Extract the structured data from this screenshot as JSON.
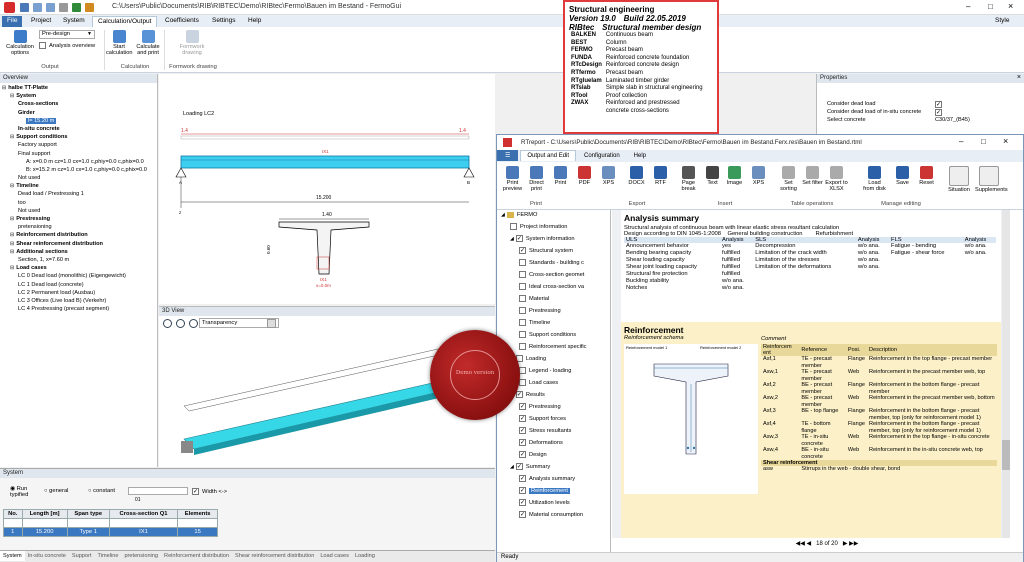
{
  "title_bar": {
    "path": "C:\\Users\\Public\\Documents\\RIB\\RIBTEC\\Demo\\RIBtec\\Fermo\\Bauen im Bestand - FermoGui"
  },
  "menu": {
    "items": [
      "File",
      "Project",
      "System",
      "Calculation/Output",
      "Coefficients",
      "Settings",
      "Help"
    ],
    "active": "Calculation/Output",
    "style_label": "Style"
  },
  "ribbon": {
    "calc_options": "Calculation options",
    "preset": "Pre-design",
    "analysis_overview": "Analysis overview",
    "group_output": "Output",
    "start_calc": "Start calculation",
    "calc_print": "Calculate and print",
    "group_calc": "Calculation",
    "formwork": "Formwork drawing",
    "group_formwork": "Formwork drawing"
  },
  "overview": {
    "header": "Overview",
    "items": [
      {
        "text": "halbe TT-Platte",
        "bold": true,
        "lvl": 0
      },
      {
        "text": "System",
        "bold": true,
        "lvl": 1
      },
      {
        "text": "Cross-sections",
        "bold": true,
        "lvl": 2
      },
      {
        "text": "Girder",
        "bold": true,
        "lvl": 2
      },
      {
        "text": "l= 15.20 m",
        "sel": true,
        "lvl": 3
      },
      {
        "text": "In-situ concrete",
        "bold": true,
        "lvl": 2
      },
      {
        "text": "Support conditions",
        "bold": true,
        "lvl": 1
      },
      {
        "text": "Factory support",
        "lvl": 2
      },
      {
        "text": "Final support",
        "lvl": 2
      },
      {
        "text": "A: x=0.0 m  cz=1.0 cx=1.0 c,phiy=0.0 c,phix=0.0",
        "lvl": 3
      },
      {
        "text": "B: x=15.2 m  cz=1.0 cx=1.0 c,phiy=0.0 c,phix=0.0",
        "lvl": 3
      },
      {
        "text": "Not used",
        "lvl": 2
      },
      {
        "text": "Timeline",
        "bold": true,
        "lvl": 1
      },
      {
        "text": "Dead load / Prestressing 1",
        "lvl": 2
      },
      {
        "text": "too",
        "lvl": 2
      },
      {
        "text": "Not used",
        "lvl": 2
      },
      {
        "text": "Prestressing",
        "bold": true,
        "lvl": 1
      },
      {
        "text": "pretensioning",
        "lvl": 2
      },
      {
        "text": "Reinforcement distribution",
        "bold": true,
        "lvl": 1
      },
      {
        "text": "Shear reinforcement distribution",
        "bold": true,
        "lvl": 1
      },
      {
        "text": "Additional sections",
        "bold": true,
        "lvl": 1
      },
      {
        "text": "Section, 1, x=7.60 m",
        "lvl": 2
      },
      {
        "text": "Load cases",
        "bold": true,
        "lvl": 1
      },
      {
        "text": "LC 0 Dead load (monolithic) (Eigengewicht)",
        "lvl": 2
      },
      {
        "text": "LC 1 Dead load (concrete)",
        "lvl": 2
      },
      {
        "text": "LC 2 Permanent load (Ausbau)",
        "lvl": 2
      },
      {
        "text": "LC 3 Offices (Live load B) (Verkehr)",
        "lvl": 2
      },
      {
        "text": "LC 4 Prestressing (precast segment)",
        "lvl": 2
      }
    ]
  },
  "drawing": {
    "loading": "Loading LC2",
    "q_left": "1.4",
    "q_right": "1.4",
    "span": "15.200",
    "ix": "IX1",
    "a": "A",
    "b": "B",
    "width": "1.40",
    "height": "0.60",
    "ix2": "IX1",
    "xpos": "x=0.0m",
    "axis": "z"
  },
  "view3d": {
    "header": "3D View",
    "transparency": "Transparency"
  },
  "system": {
    "header": "System",
    "radio": [
      "Run typified",
      "general",
      "constant"
    ],
    "width_label": "Width <->",
    "field": "01",
    "cols": [
      "No.",
      "Length [m]",
      "Span type",
      "Cross-section Q1",
      "Elements"
    ],
    "row": [
      "1",
      "15.200",
      "Type 1",
      "IX1",
      "15"
    ]
  },
  "bottom_tabs": [
    "System",
    "In-situ concrete",
    "Support",
    "Timeline",
    "pretensioning",
    "Reinforcement distribution",
    "Shear reinforcement distribution",
    "Load cases",
    "Loading"
  ],
  "properties": {
    "header": "Properties",
    "rows": [
      {
        "label": "Consider dead load",
        "value": "checked"
      },
      {
        "label": "Consider dead load of in-situ concrete",
        "value": "checked"
      },
      {
        "label": "Select concrete",
        "value": "C30/37_(B45)"
      }
    ]
  },
  "info": {
    "title": "Structural engineering",
    "version": "Version 19.0",
    "build": "Build  22.05.2019",
    "ribtec": "RIBtec",
    "sub": "Structural member design",
    "mods": [
      [
        "BALKEN",
        "Continuous beam"
      ],
      [
        "BEST",
        "Column"
      ],
      [
        "FERMO",
        "Precast beam"
      ],
      [
        "FUNDA",
        "Reinforced concrete foundation"
      ],
      [
        "RTcDesign",
        "Reinforced concrete design"
      ],
      [
        "RTfermo",
        "Precast beam"
      ],
      [
        "RTgluelam",
        "Laminated timber girder"
      ],
      [
        "RTslab",
        "Simple slab in structural engineering"
      ],
      [
        "RTool",
        "Proof collection"
      ],
      [
        "ZWAX",
        "Reinforced and prestressed"
      ],
      [
        "",
        "concrete cross-sections"
      ]
    ]
  },
  "rt": {
    "title": "RTreport - C:\\Users\\Public\\Documents\\RIB\\RIBTEC\\Demo\\RIBtec\\Fermo\\Bauen im Bestand.Ferx.res\\Bauen im Bestand.rtml",
    "tabs": [
      "Output and Edit",
      "Configuration",
      "Help"
    ],
    "buttons": [
      "Print preview",
      "Direct print",
      "Print",
      "PDF",
      "XPS",
      "DOCX",
      "RTF",
      "Page break",
      "Text",
      "Image",
      "XPS",
      "Set sorting",
      "Set filter",
      "Export to XLSX",
      "Load from disk",
      "Save",
      "Reset",
      "Situation",
      "Supplements"
    ],
    "groups": [
      "Print",
      "Export",
      "Insert",
      "Table operations",
      "Manage editing"
    ],
    "tree": [
      {
        "t": "FERMO",
        "lvl": 0,
        "cb": false,
        "exp": true
      },
      {
        "t": "Project information",
        "lvl": 1,
        "cb": "off"
      },
      {
        "t": "System information",
        "lvl": 1,
        "cb": "on",
        "exp": true
      },
      {
        "t": "Structural system",
        "lvl": 2,
        "cb": "on"
      },
      {
        "t": "Standards - building c",
        "lvl": 2,
        "cb": "off"
      },
      {
        "t": "Cross-section geomet",
        "lvl": 2,
        "cb": "off"
      },
      {
        "t": "Ideal cross-section va",
        "lvl": 2,
        "cb": "off"
      },
      {
        "t": "Material",
        "lvl": 2,
        "cb": "off"
      },
      {
        "t": "Prestressing",
        "lvl": 2,
        "cb": "off"
      },
      {
        "t": "Timeline",
        "lvl": 2,
        "cb": "off"
      },
      {
        "t": "Support conditions",
        "lvl": 2,
        "cb": "off"
      },
      {
        "t": "Reinforcement specific",
        "lvl": 2,
        "cb": "off"
      },
      {
        "t": "Loading",
        "lvl": 1,
        "cb": "off",
        "exp": true
      },
      {
        "t": "Legend - loading",
        "lvl": 2,
        "cb": "off"
      },
      {
        "t": "Load cases",
        "lvl": 2,
        "cb": "off"
      },
      {
        "t": "Results",
        "lvl": 1,
        "cb": "on",
        "exp": true
      },
      {
        "t": "Prestressing",
        "lvl": 2,
        "cb": "on"
      },
      {
        "t": "Support forces",
        "lvl": 2,
        "cb": "on"
      },
      {
        "t": "Stress resultants",
        "lvl": 2,
        "cb": "on"
      },
      {
        "t": "Deformations",
        "lvl": 2,
        "cb": "on"
      },
      {
        "t": "Design",
        "lvl": 2,
        "cb": "on"
      },
      {
        "t": "Summary",
        "lvl": 1,
        "cb": "on",
        "exp": true
      },
      {
        "t": "Analysis summary",
        "lvl": 2,
        "cb": "on"
      },
      {
        "t": "Reinforcement",
        "lvl": 2,
        "cb": "on",
        "sel": true
      },
      {
        "t": "Utilization levels",
        "lvl": 2,
        "cb": "on"
      },
      {
        "t": "Material consumption",
        "lvl": 2,
        "cb": "on"
      }
    ],
    "analysis": {
      "heading": "Analysis summary",
      "line1": "Structural analysis of continuous beam   with linear elastic stress resultant calculation",
      "line2a": "Design according to DIN 1045-1:2008",
      "line2b": "General building construction",
      "line2c": "Refurbishment",
      "cols": [
        "ULS",
        "Analysis",
        "SLS",
        "Analysis",
        "FLS",
        "Analysis"
      ],
      "rows": [
        [
          "Announcement behavior",
          "yes",
          "Decompression",
          "w/o ana.",
          "Fatigue - bending",
          "w/o ana."
        ],
        [
          "Bending bearing capacity",
          "fulfilled",
          "Limitation of the crack width",
          "w/o ana.",
          "Fatigue - shear force",
          "w/o ana."
        ],
        [
          "Shear loading capacity",
          "fulfilled",
          "Limitation of the stresses",
          "w/o ana.",
          "",
          ""
        ],
        [
          "Shear joint loading capacity",
          "fulfilled",
          "Limitation of the deformations",
          "w/o ana.",
          "",
          ""
        ],
        [
          "Structural fire protection",
          "fulfilled",
          "",
          "",
          "",
          ""
        ],
        [
          "Buckling stability",
          "w/o ana.",
          "",
          "",
          "",
          ""
        ],
        [
          "Notches",
          "w/o ana.",
          "",
          "",
          "",
          ""
        ]
      ]
    },
    "reinf": {
      "heading": "Reinforcement",
      "schema": "Reinforcement schema",
      "model1": "Reinforcement model 1",
      "model2": "Reinforcement model 2",
      "comment": "Comment",
      "cols": [
        "Reinforcem ent",
        "Reference",
        "Posi.",
        "Description"
      ],
      "rows": [
        [
          "Asf,1",
          "TE - precast member",
          "Flange",
          "Reinforcement in the top flange - precast member"
        ],
        [
          "Asw,1",
          "TE - precast member",
          "Web",
          "Reinforcement in the precast member web, top"
        ],
        [
          "Asf,2",
          "BE - precast member",
          "Flange",
          "Reinforcement in the bottom flange - precast member"
        ],
        [
          "Asw,2",
          "BE - precast member",
          "Web",
          "Reinforcement in the precast member web, bottom"
        ],
        [
          "Asf,3",
          "BE - top flange",
          "Flange",
          "Reinforcement in the bottom flange - precast member, top (only for reinforcement model 1)"
        ],
        [
          "Asf,4",
          "TE - bottom flange",
          "Flange",
          "Reinforcement in the bottom flange - precast member, top (only for reinforcement model 1)"
        ],
        [
          "Asw,3",
          "TE - in-situ concrete",
          "Web",
          "Reinforcement in the top flange - in-situ concrete"
        ],
        [
          "Asw,4",
          "BE - in-situ concrete",
          "Web",
          "Reinforcement in the in-situ concrete web, top"
        ]
      ],
      "shear": "Shear reinforcement",
      "shear_sym": "asw",
      "shear_desc": "Stirrups in the web - double shear, bond"
    },
    "pager": "18 of 20",
    "status": "Ready"
  },
  "seal_text": "Demo version"
}
